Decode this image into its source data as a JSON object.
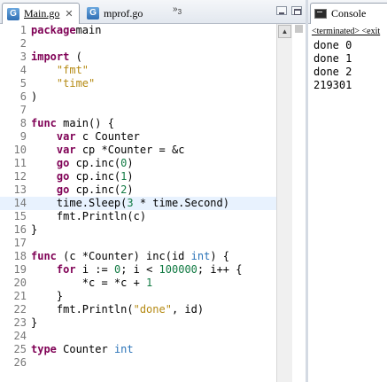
{
  "editor": {
    "tabs": [
      {
        "label": "Main.go",
        "icon": "go-file-icon",
        "active": true
      },
      {
        "label": "mprof.go",
        "icon": "go-file-icon",
        "active": false
      }
    ],
    "overflow_count": "3",
    "lines": [
      {
        "n": "1",
        "tokens": [
          [
            "kw",
            "package"
          ],
          [
            "",
            "main"
          ]
        ]
      },
      {
        "n": "2",
        "tokens": []
      },
      {
        "n": "3",
        "tokens": [
          [
            "kw",
            "import"
          ],
          [
            "",
            " ("
          ]
        ]
      },
      {
        "n": "4",
        "tokens": [
          [
            "",
            "    "
          ],
          [
            "str",
            "\"fmt\""
          ]
        ]
      },
      {
        "n": "5",
        "tokens": [
          [
            "",
            "    "
          ],
          [
            "str",
            "\"time\""
          ]
        ]
      },
      {
        "n": "6",
        "tokens": [
          [
            "",
            ")"
          ]
        ]
      },
      {
        "n": "7",
        "tokens": []
      },
      {
        "n": "8",
        "tokens": [
          [
            "kw",
            "func"
          ],
          [
            "",
            " main() {"
          ]
        ]
      },
      {
        "n": "9",
        "tokens": [
          [
            "",
            "    "
          ],
          [
            "kw",
            "var"
          ],
          [
            "",
            " c Counter"
          ]
        ]
      },
      {
        "n": "10",
        "tokens": [
          [
            "",
            "    "
          ],
          [
            "kw",
            "var"
          ],
          [
            "",
            " cp *Counter = &c"
          ]
        ]
      },
      {
        "n": "11",
        "tokens": [
          [
            "",
            "    "
          ],
          [
            "kw",
            "go"
          ],
          [
            "",
            " cp.inc("
          ],
          [
            "num",
            "0"
          ],
          [
            "",
            ")"
          ]
        ]
      },
      {
        "n": "12",
        "tokens": [
          [
            "",
            "    "
          ],
          [
            "kw",
            "go"
          ],
          [
            "",
            " cp.inc("
          ],
          [
            "num",
            "1"
          ],
          [
            "",
            ")"
          ]
        ]
      },
      {
        "n": "13",
        "tokens": [
          [
            "",
            "    "
          ],
          [
            "kw",
            "go"
          ],
          [
            "",
            " cp.inc("
          ],
          [
            "num",
            "2"
          ],
          [
            "",
            ")"
          ]
        ]
      },
      {
        "n": "14",
        "tokens": [
          [
            "",
            "    time.Sleep("
          ],
          [
            "num",
            "3"
          ],
          [
            "",
            " * time.Second)"
          ]
        ],
        "highlight": true
      },
      {
        "n": "15",
        "tokens": [
          [
            "",
            "    fmt.Println(c)"
          ]
        ]
      },
      {
        "n": "16",
        "tokens": [
          [
            "",
            "}"
          ]
        ]
      },
      {
        "n": "17",
        "tokens": []
      },
      {
        "n": "18",
        "tokens": [
          [
            "kw",
            "func"
          ],
          [
            "",
            " (c *Counter) inc(id "
          ],
          [
            "ty",
            "int"
          ],
          [
            "",
            ") {"
          ]
        ]
      },
      {
        "n": "19",
        "tokens": [
          [
            "",
            "    "
          ],
          [
            "kw",
            "for"
          ],
          [
            "",
            " i := "
          ],
          [
            "num",
            "0"
          ],
          [
            "",
            "; i < "
          ],
          [
            "num",
            "100000"
          ],
          [
            "",
            "; i++ {"
          ]
        ]
      },
      {
        "n": "20",
        "tokens": [
          [
            "",
            "        *c = *c + "
          ],
          [
            "num",
            "1"
          ]
        ]
      },
      {
        "n": "21",
        "tokens": [
          [
            "",
            "    }"
          ]
        ]
      },
      {
        "n": "22",
        "tokens": [
          [
            "",
            "    fmt.Println("
          ],
          [
            "str",
            "\"done\""
          ],
          [
            "",
            ", id)"
          ]
        ]
      },
      {
        "n": "23",
        "tokens": [
          [
            "",
            "}"
          ]
        ]
      },
      {
        "n": "24",
        "tokens": []
      },
      {
        "n": "25",
        "tokens": [
          [
            "kw",
            "type"
          ],
          [
            "",
            " Counter "
          ],
          [
            "ty",
            "int"
          ]
        ]
      },
      {
        "n": "26",
        "tokens": []
      }
    ]
  },
  "console": {
    "tab_label": "Console",
    "status": "<terminated> <exit",
    "output": [
      "done 0",
      "done 1",
      "done 2",
      "219301"
    ]
  },
  "colors": {
    "keyword": "#7f0055",
    "type": "#2a73b8",
    "string": "#b58a13",
    "number": "#117a43",
    "current_line": "#e8f2fe"
  }
}
